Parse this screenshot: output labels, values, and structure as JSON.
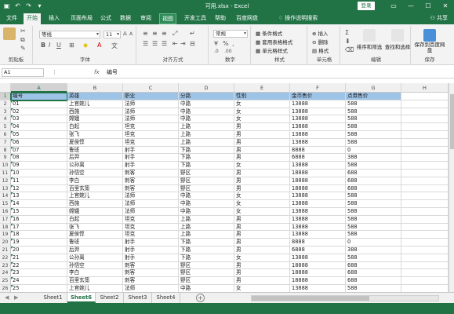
{
  "title": "可用.xlsx - Excel",
  "login": "登录",
  "share": "共享",
  "tabs": [
    "文件",
    "开始",
    "插入",
    "页面布局",
    "公式",
    "数据",
    "审阅",
    "视图",
    "开发工具",
    "帮助",
    "百度网盘",
    "操作说明搜索"
  ],
  "active_tab": "开始",
  "ribbon": {
    "font_name": "等线",
    "font_size": "11",
    "number_format": "常规",
    "groups": [
      "剪贴板",
      "字体",
      "对齐方式",
      "数字",
      "样式",
      "单元格",
      "编辑",
      "保存"
    ],
    "styles": [
      "条件格式",
      "套用表格格式",
      "单元格样式"
    ],
    "cells": [
      "插入",
      "删除",
      "格式"
    ],
    "editing": [
      "排序和筛选",
      "查找和选择"
    ],
    "save": "保存到百度网盘"
  },
  "formula_bar": {
    "name_box": "A1",
    "content": "编号"
  },
  "columns": [
    "A",
    "B",
    "C",
    "D",
    "E",
    "F",
    "G",
    "H"
  ],
  "headers": [
    "编号",
    "英雄",
    "职业",
    "分路",
    "性别",
    "金币售价",
    "点券售价"
  ],
  "rows": [
    [
      "01",
      "上官婉儿",
      "法师",
      "中路",
      "女",
      "13888",
      "588"
    ],
    [
      "02",
      "西施",
      "法师",
      "中路",
      "女",
      "13888",
      "588"
    ],
    [
      "03",
      "嫦娥",
      "法师",
      "中路",
      "女",
      "13888",
      "588"
    ],
    [
      "04",
      "白起",
      "坦克",
      "上路",
      "男",
      "13888",
      "588"
    ],
    [
      "05",
      "张飞",
      "坦克",
      "上路",
      "男",
      "13888",
      "588"
    ],
    [
      "06",
      "夏侯惇",
      "坦克",
      "上路",
      "男",
      "13888",
      "588"
    ],
    [
      "07",
      "鲁班",
      "射手",
      "下路",
      "男",
      "8888",
      "0"
    ],
    [
      "08",
      "后羿",
      "射手",
      "下路",
      "男",
      "6888",
      "388"
    ],
    [
      "09",
      "公孙离",
      "射手",
      "下路",
      "女",
      "13888",
      "588"
    ],
    [
      "10",
      "孙悟空",
      "刺客",
      "野区",
      "男",
      "18888",
      "688"
    ],
    [
      "11",
      "李白",
      "刺客",
      "野区",
      "男",
      "18888",
      "688"
    ],
    [
      "12",
      "百里玄策",
      "刺客",
      "野区",
      "男",
      "18888",
      "688"
    ],
    [
      "13",
      "上官婉儿",
      "法师",
      "中路",
      "女",
      "13888",
      "588"
    ],
    [
      "14",
      "西施",
      "法师",
      "中路",
      "女",
      "13888",
      "588"
    ],
    [
      "15",
      "嫦娥",
      "法师",
      "中路",
      "女",
      "13888",
      "588"
    ],
    [
      "16",
      "白起",
      "坦克",
      "上路",
      "男",
      "13888",
      "588"
    ],
    [
      "17",
      "张飞",
      "坦克",
      "上路",
      "男",
      "13888",
      "588"
    ],
    [
      "18",
      "夏侯惇",
      "坦克",
      "上路",
      "男",
      "13888",
      "588"
    ],
    [
      "19",
      "鲁班",
      "射手",
      "下路",
      "男",
      "8888",
      "0"
    ],
    [
      "20",
      "后羿",
      "射手",
      "下路",
      "男",
      "6888",
      "388"
    ],
    [
      "21",
      "公孙离",
      "射手",
      "下路",
      "女",
      "13888",
      "588"
    ],
    [
      "22",
      "孙悟空",
      "刺客",
      "野区",
      "男",
      "18888",
      "688"
    ],
    [
      "23",
      "李白",
      "刺客",
      "野区",
      "男",
      "18888",
      "688"
    ],
    [
      "24",
      "百里玄策",
      "刺客",
      "野区",
      "男",
      "18888",
      "688"
    ],
    [
      "25",
      "上官婉儿",
      "法师",
      "中路",
      "女",
      "13888",
      "588"
    ]
  ],
  "sheets": [
    "Sheet1",
    "Sheet6",
    "Sheet2",
    "Sheet3",
    "Sheet4"
  ],
  "active_sheet": "Sheet6",
  "colors": {
    "excel_green": "#217346",
    "header_fill": "#9dc3e6"
  }
}
